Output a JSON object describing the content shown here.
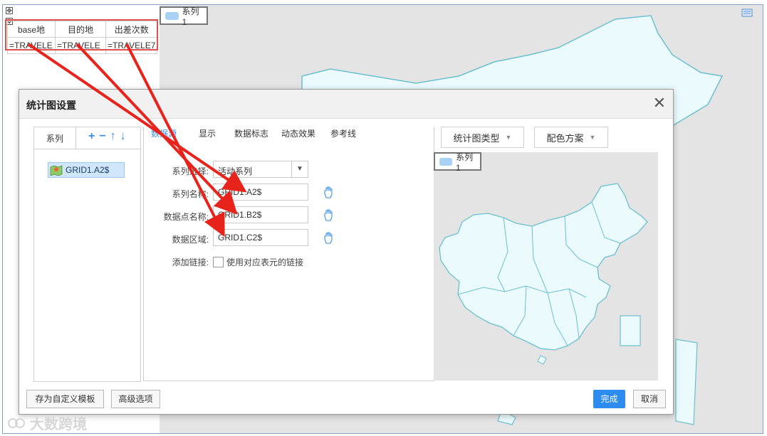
{
  "legend": {
    "series_label": "系列1"
  },
  "sheet": {
    "headers": [
      "base地",
      "目的地",
      "出差次数"
    ],
    "formulas": [
      "=TRAVELE",
      "=TRAVELE",
      "=TRAVELE7"
    ]
  },
  "dialog": {
    "title": "统计图设置",
    "close_label": "✕",
    "series_tab": "系列",
    "series_tools": {
      "add": "+",
      "remove": "−",
      "up": "↑",
      "down": "↓"
    },
    "series_item": "GRID1.A2$",
    "tabs": [
      "数据源",
      "显示",
      "数据标志",
      "动态效果",
      "参考线"
    ],
    "form": {
      "series_select_label": "系列选择:",
      "series_select_value": "活动系列",
      "series_name_label": "系列名称:",
      "series_name_value": "GRID1.A2$",
      "point_name_label": "数据点名称:",
      "point_name_value": "GRID1.B2$",
      "data_range_label": "数据区域:",
      "data_range_value": "GRID1.C2$",
      "link_label": "添加链接:",
      "link_checkbox_text": "使用对应表元的链接"
    },
    "chart_type_button": "统计图类型",
    "color_scheme_button": "配色方案",
    "preview_legend": "系列1",
    "footer": {
      "save_template": "存为自定义模板",
      "advanced": "高级选项",
      "ok": "完成",
      "cancel": "取消"
    }
  },
  "watermark": "大数跨境",
  "colors": {
    "accent": "#2d8cf0",
    "map_fill": "#eafafd",
    "map_stroke": "#6cbfcf",
    "arrow": "#e8231c"
  }
}
